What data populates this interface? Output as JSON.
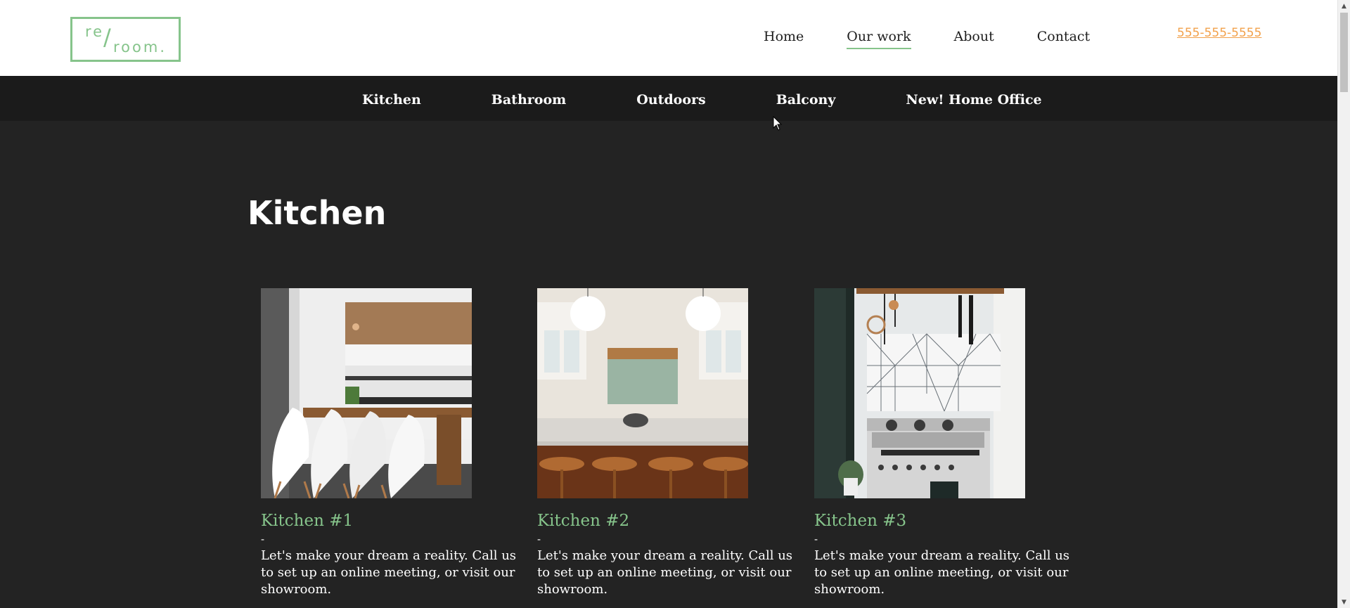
{
  "header": {
    "logo": {
      "top": "re",
      "slash": "/",
      "bottom": "room."
    },
    "nav": [
      {
        "label": "Home",
        "active": false
      },
      {
        "label": "Our work",
        "active": true
      },
      {
        "label": "About",
        "active": false
      },
      {
        "label": "Contact",
        "active": false
      }
    ],
    "phone": "555-555-5555"
  },
  "subnav": {
    "items": [
      {
        "label": "Kitchen"
      },
      {
        "label": "Bathroom"
      },
      {
        "label": "Outdoors"
      },
      {
        "label": "Balcony"
      },
      {
        "label": "New! Home Office"
      }
    ]
  },
  "main": {
    "section_title": "Kitchen",
    "cards": [
      {
        "title": "Kitchen #1",
        "dash": "-",
        "desc": "Let's make your dream a reality. Call us to set up an online meeting, or visit our showroom."
      },
      {
        "title": "Kitchen #2",
        "dash": "-",
        "desc": "Let's make your dream a reality. Call us to set up an online meeting, or visit our showroom."
      },
      {
        "title": "Kitchen #3",
        "dash": "-",
        "desc": "Let's make your dream a reality. Call us to set up an online meeting, or visit our showroom."
      }
    ]
  },
  "colors": {
    "brand_green": "#86c48b",
    "phone_orange": "#f2a14b",
    "header_bg": "#ffffff",
    "subnav_bg": "#1b1b1b",
    "page_bg": "#232323"
  },
  "icons": {
    "cursor": "arrow-cursor-icon",
    "scroll_up": "scroll-up-arrow-icon",
    "scroll_down": "scroll-down-arrow-icon"
  }
}
